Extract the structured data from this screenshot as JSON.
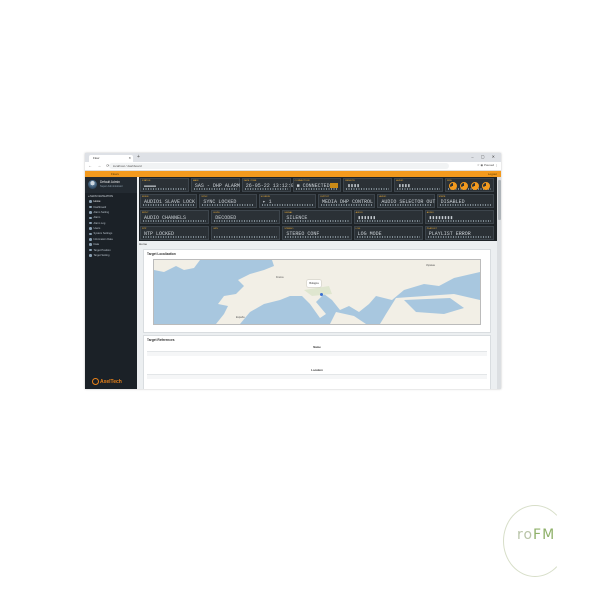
{
  "browser": {
    "tab_title": "Flow",
    "new_tab": "+",
    "window_controls": "– ▢ ✕",
    "nav_glyphs": "← → ⟳",
    "url": "localhost / dashboard",
    "addr_right": "☆ ◉ Paused ⋮"
  },
  "topbar": {
    "left": "Flows",
    "right": "Logout"
  },
  "sidebar": {
    "user_name": "Default Admin",
    "user_role": "Super Administrator",
    "section": "≡ MAIN NAVIGATION",
    "items": [
      {
        "label": "Home"
      },
      {
        "label": "Dashboard"
      },
      {
        "label": "Alarm Setting"
      },
      {
        "label": "Alarm"
      },
      {
        "label": "Alarm Log"
      },
      {
        "label": "Users"
      },
      {
        "label": "System Settings"
      },
      {
        "label": "Information Data"
      },
      {
        "label": "Data"
      },
      {
        "label": "Target Position"
      },
      {
        "label": "Target Setting"
      }
    ],
    "logo": "AxelTech"
  },
  "dashboard": {
    "row1": [
      {
        "label": "STATUS",
        "value": "▬▬▬▬"
      },
      {
        "label": "MAIN",
        "value": "SAS - DHP ALARM"
      },
      {
        "label": "DATE / TIME",
        "value": "26-05-22 13:12:09"
      },
      {
        "label": "CONNECTION",
        "value": "■ CONNECTED"
      },
      {
        "label": "REMOTE",
        "value": "▮▮▮▮"
      },
      {
        "label": "AUDIO",
        "value": "▮▮▮▮"
      },
      {
        "label": "RDS",
        "value": ""
      }
    ],
    "row2": [
      {
        "label": "MODE",
        "value": "AUDIO1 SLAVE LOCK"
      },
      {
        "label": "SYNC",
        "value": "SYNC LOCKED"
      },
      {
        "label": "SOURCE",
        "value": "▸ 1"
      },
      {
        "label": "OUTPUT",
        "value": "MEDIA DHP CONTROL"
      },
      {
        "label": "AUDIO",
        "value": "AUDIO SELECTOR OUT"
      },
      {
        "label": "STATE",
        "value": "DISABLED"
      }
    ],
    "row3": [
      {
        "label": "INPUT",
        "value": "AUDIO CHANNELS"
      },
      {
        "label": "LEVEL",
        "value": "DECODED"
      },
      {
        "label": "SIGNAL",
        "value": "SILENCE"
      },
      {
        "label": "AUDIO",
        "value": "▮▮▮▮▮▮"
      },
      {
        "label": "AUDIO",
        "value": "▮▮▮▮▮▮▮▮"
      }
    ],
    "row4": [
      {
        "label": "NTP",
        "value": "NTP LOCKED"
      },
      {
        "label": "GPS",
        "value": ""
      },
      {
        "label": "STEREO",
        "value": "STEREO CONF"
      },
      {
        "label": "LOG",
        "value": "LOG MODE"
      },
      {
        "label": "PLAYLIST",
        "value": "PLAYLIST ERROR"
      }
    ]
  },
  "breadcrumb": "Home",
  "panel1": {
    "title": "Target Localization",
    "marker": "Bologna",
    "labels": {
      "france": "France",
      "spain": "España",
      "ukraine": "Україна"
    }
  },
  "panel2": {
    "title": "Target References",
    "col1": "Name",
    "col2": "Location"
  },
  "watermark": {
    "ring": "",
    "text_a": "ro",
    "text_b": "FM"
  },
  "colors": {
    "accent": "#f39a1e",
    "sidebar": "#1b2127",
    "map_sea": "#a8c7df"
  }
}
